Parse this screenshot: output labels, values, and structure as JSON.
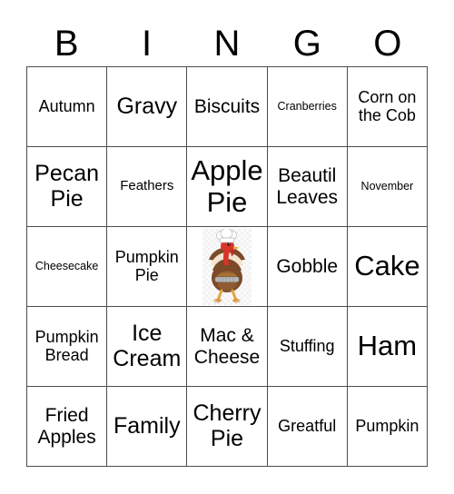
{
  "header": {
    "letters": [
      "B",
      "I",
      "N",
      "G",
      "O"
    ]
  },
  "grid": {
    "rows": 5,
    "columns": 5,
    "cells": [
      {
        "label": "Autumn",
        "size": "md"
      },
      {
        "label": "Gravy",
        "size": "xl"
      },
      {
        "label": "Biscuits",
        "size": "lg"
      },
      {
        "label": "Cranberries",
        "size": "xs"
      },
      {
        "label": "Corn on the Cob",
        "size": "md"
      },
      {
        "label": "Pecan Pie",
        "size": "xl"
      },
      {
        "label": "Feathers",
        "size": "sm"
      },
      {
        "label": "Apple Pie",
        "size": "xxl"
      },
      {
        "label": "Beautil Leaves",
        "size": "lg"
      },
      {
        "label": "November",
        "size": "xs"
      },
      {
        "label": "Cheesecake",
        "size": "xs"
      },
      {
        "label": "Pumpkin Pie",
        "size": "md"
      },
      {
        "label": "",
        "size": "md",
        "free": true,
        "icon": "turkey-chef-icon"
      },
      {
        "label": "Gobble",
        "size": "lg"
      },
      {
        "label": "Cake",
        "size": "xxl"
      },
      {
        "label": "Pumpkin Bread",
        "size": "md"
      },
      {
        "label": "Ice Cream",
        "size": "xl"
      },
      {
        "label": "Mac & Cheese",
        "size": "lg"
      },
      {
        "label": "Stuffing",
        "size": "md"
      },
      {
        "label": "Ham",
        "size": "xxl"
      },
      {
        "label": "Fried Apples",
        "size": "lg"
      },
      {
        "label": "Family",
        "size": "xl"
      },
      {
        "label": "Cherry Pie",
        "size": "xl"
      },
      {
        "label": "Greatful",
        "size": "md"
      },
      {
        "label": "Pumpkin",
        "size": "md"
      }
    ]
  },
  "colors": {
    "border": "#4d4d4d",
    "text": "#000000",
    "background": "#ffffff",
    "turkey_body": "#7b4a28",
    "turkey_body_light": "#a3693c",
    "turkey_head": "#d9342b",
    "turkey_beak": "#f0a830",
    "turkey_legs": "#e8a33d",
    "chef_hat": "#ffffff",
    "tray": "#b8b8b8"
  }
}
